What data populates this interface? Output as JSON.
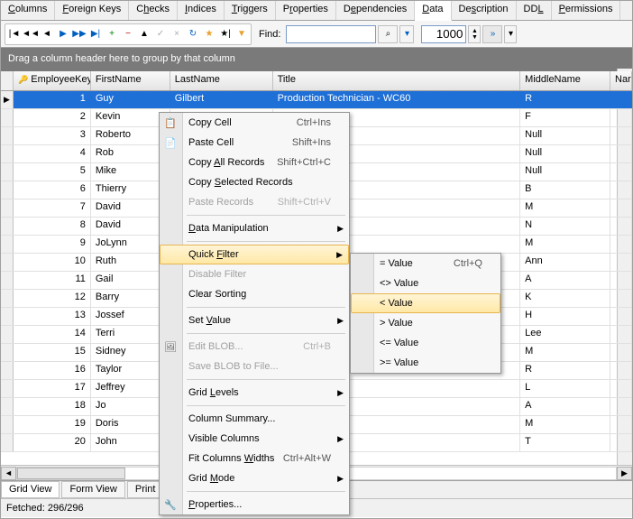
{
  "tabs": [
    {
      "label": "Columns",
      "u": "C"
    },
    {
      "label": "Foreign Keys",
      "u": "F"
    },
    {
      "label": "Checks",
      "u": "h"
    },
    {
      "label": "Indices",
      "u": "I"
    },
    {
      "label": "Triggers",
      "u": "T"
    },
    {
      "label": "Properties",
      "u": "r"
    },
    {
      "label": "Dependencies",
      "u": "e"
    },
    {
      "label": "Data",
      "u": "D",
      "active": true
    },
    {
      "label": "Description",
      "u": "s"
    },
    {
      "label": "DDL",
      "u": "L"
    },
    {
      "label": "Permissions",
      "u": "P"
    }
  ],
  "toolbar": {
    "find_label": "Find:",
    "find_value": "",
    "spin_value": "1000"
  },
  "group_bar": "Drag a column header here to group by that column",
  "columns": [
    "EmployeeKey",
    "FirstName",
    "LastName",
    "Title",
    "MiddleName",
    "Nar"
  ],
  "rows": [
    {
      "key": "1",
      "fn": "Guy",
      "ln": "Gilbert",
      "title": "Production Technician - WC60",
      "mn": "R",
      "sel": true
    },
    {
      "key": "2",
      "fn": "Kevin",
      "ln": "",
      "title": "ant",
      "mn": "F"
    },
    {
      "key": "3",
      "fn": "Roberto",
      "ln": "",
      "title": "ager",
      "mn": "Null"
    },
    {
      "key": "4",
      "fn": "Rob",
      "ln": "",
      "title": "ner",
      "mn": "Null"
    },
    {
      "key": "5",
      "fn": "Mike",
      "ln": "",
      "title": "",
      "mn": "Null"
    },
    {
      "key": "6",
      "fn": "Thierry",
      "ln": "",
      "title": "",
      "mn": "B"
    },
    {
      "key": "7",
      "fn": "David",
      "ln": "",
      "title": "er",
      "mn": "M"
    },
    {
      "key": "8",
      "fn": "David",
      "ln": "",
      "title": "er",
      "mn": "N"
    },
    {
      "key": "9",
      "fn": "JoLynn",
      "ln": "",
      "title": "",
      "mn": "M"
    },
    {
      "key": "10",
      "fn": "Ruth",
      "ln": "",
      "title": "",
      "mn": "Ann"
    },
    {
      "key": "11",
      "fn": "Gail",
      "ln": "",
      "title": "",
      "mn": "A"
    },
    {
      "key": "12",
      "fn": "Barry",
      "ln": "",
      "title": "",
      "mn": "K"
    },
    {
      "key": "13",
      "fn": "Jossef",
      "ln": "",
      "title": "",
      "mn": "H"
    },
    {
      "key": "14",
      "fn": "Terri",
      "ln": "",
      "title": "",
      "mn": "Lee"
    },
    {
      "key": "15",
      "fn": "Sidney",
      "ln": "",
      "title": "",
      "mn": "M"
    },
    {
      "key": "16",
      "fn": "Taylor",
      "ln": "",
      "title": "visor - WC50",
      "mn": "R"
    },
    {
      "key": "17",
      "fn": "Jeffrey",
      "ln": "",
      "title": "ician - WC10",
      "mn": "L"
    },
    {
      "key": "18",
      "fn": "Jo",
      "ln": "",
      "title": "visor - WC60",
      "mn": "A"
    },
    {
      "key": "19",
      "fn": "Doris",
      "ln": "",
      "title": "ician - WC10",
      "mn": "M"
    },
    {
      "key": "20",
      "fn": "John",
      "ln": "",
      "title": "visor - WC60",
      "mn": "T"
    }
  ],
  "bottom_tabs": [
    {
      "label": "Grid View",
      "active": true
    },
    {
      "label": "Form View"
    },
    {
      "label": "Print D"
    }
  ],
  "status": "Fetched: 296/296",
  "context_menu": {
    "items": [
      {
        "type": "item",
        "label": "Copy Cell",
        "u": "",
        "shortcut": "Ctrl+Ins",
        "icon": "copy"
      },
      {
        "type": "item",
        "label": "Paste Cell",
        "u": "",
        "shortcut": "Shift+Ins",
        "icon": "paste"
      },
      {
        "type": "item",
        "label": "Copy All Records",
        "u": "A",
        "shortcut": "Shift+Ctrl+C"
      },
      {
        "type": "item",
        "label": "Copy Selected Records",
        "u": "S"
      },
      {
        "type": "item",
        "label": "Paste Records",
        "shortcut": "Shift+Ctrl+V",
        "disabled": true
      },
      {
        "type": "sep"
      },
      {
        "type": "item",
        "label": "Data Manipulation",
        "u": "D",
        "submenu": true
      },
      {
        "type": "sep"
      },
      {
        "type": "item",
        "label": "Quick Filter",
        "u": "F",
        "submenu": true,
        "hover": true
      },
      {
        "type": "item",
        "label": "Disable Filter",
        "disabled": true
      },
      {
        "type": "item",
        "label": "Clear Sorting"
      },
      {
        "type": "sep"
      },
      {
        "type": "item",
        "label": "Set Value",
        "u": "V",
        "submenu": true
      },
      {
        "type": "sep"
      },
      {
        "type": "item",
        "label": "Edit BLOB...",
        "shortcut": "Ctrl+B",
        "disabled": true,
        "icon": "blob"
      },
      {
        "type": "item",
        "label": "Save BLOB to File...",
        "disabled": true
      },
      {
        "type": "sep"
      },
      {
        "type": "item",
        "label": "Grid Levels",
        "u": "L",
        "submenu": true
      },
      {
        "type": "sep"
      },
      {
        "type": "item",
        "label": "Column Summary..."
      },
      {
        "type": "item",
        "label": "Visible Columns",
        "submenu": true
      },
      {
        "type": "item",
        "label": "Fit Columns Widths",
        "u": "W",
        "shortcut": "Ctrl+Alt+W"
      },
      {
        "type": "item",
        "label": "Grid Mode",
        "u": "M",
        "submenu": true
      },
      {
        "type": "sep"
      },
      {
        "type": "item",
        "label": "Properties...",
        "u": "P",
        "icon": "props"
      }
    ],
    "submenu": [
      {
        "label": "= Value",
        "shortcut": "Ctrl+Q"
      },
      {
        "label": "<> Value"
      },
      {
        "label": "< Value",
        "hover": true
      },
      {
        "label": "> Value"
      },
      {
        "label": "<= Value"
      },
      {
        "label": ">= Value"
      }
    ]
  }
}
